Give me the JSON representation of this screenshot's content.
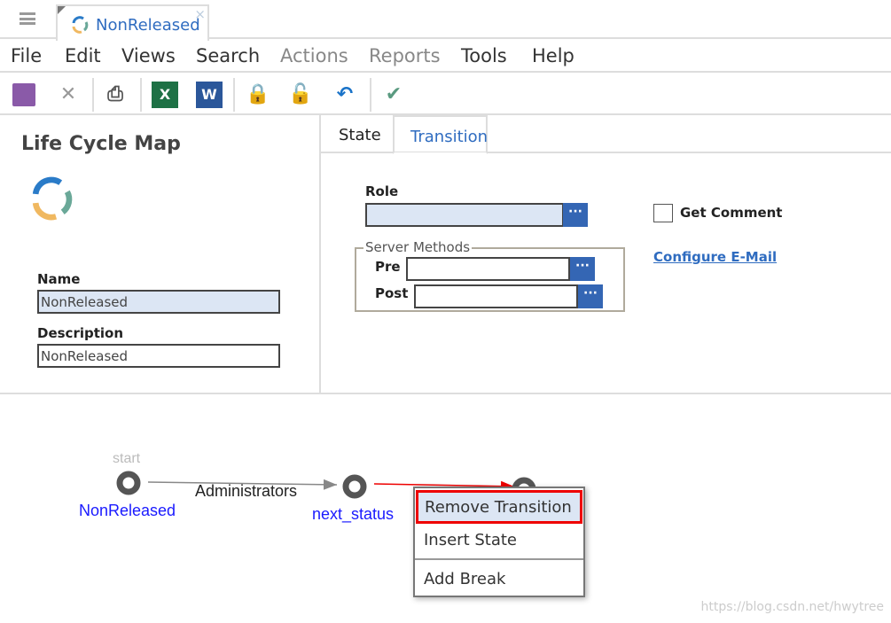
{
  "tab": {
    "title": "NonReleased",
    "close": "×"
  },
  "menu": [
    {
      "label": "File",
      "enabled": true
    },
    {
      "label": "Edit",
      "enabled": true
    },
    {
      "label": "Views",
      "enabled": true
    },
    {
      "label": "Search",
      "enabled": true
    },
    {
      "label": "Actions",
      "enabled": false
    },
    {
      "label": "Reports",
      "enabled": false
    },
    {
      "label": "Tools",
      "enabled": true
    },
    {
      "label": "Help",
      "enabled": true
    }
  ],
  "toolbar": [
    "save-icon",
    "discard-icon",
    "print-icon",
    "excel-icon",
    "word-icon",
    "lock-icon",
    "unlock-icon",
    "undo-icon",
    "done-icon"
  ],
  "left": {
    "title": "Life Cycle Map",
    "name_label": "Name",
    "name_value": "NonReleased",
    "desc_label": "Description",
    "desc_value": "NonReleased"
  },
  "right": {
    "tabs": [
      "State",
      "Transition"
    ],
    "active_tab": "Transition",
    "role_label": "Role",
    "role_value": "",
    "get_comment_label": "Get Comment",
    "get_comment_checked": false,
    "server_methods_label": "Server Methods",
    "pre_label": "Pre",
    "post_label": "Post",
    "configure_email": "Configure E-Mail",
    "dots": "···"
  },
  "diagram": {
    "start_label": "start",
    "state1": "NonReleased",
    "transition1": "Administrators",
    "state2": "next_status"
  },
  "context_menu": [
    "Remove Transition",
    "Insert State",
    "Add Break"
  ],
  "watermark": "https://blog.csdn.net/hwytree",
  "colors": {
    "accent": "#3466b4",
    "highlight": "#dce6f4",
    "selected_transition": "#e00000"
  }
}
